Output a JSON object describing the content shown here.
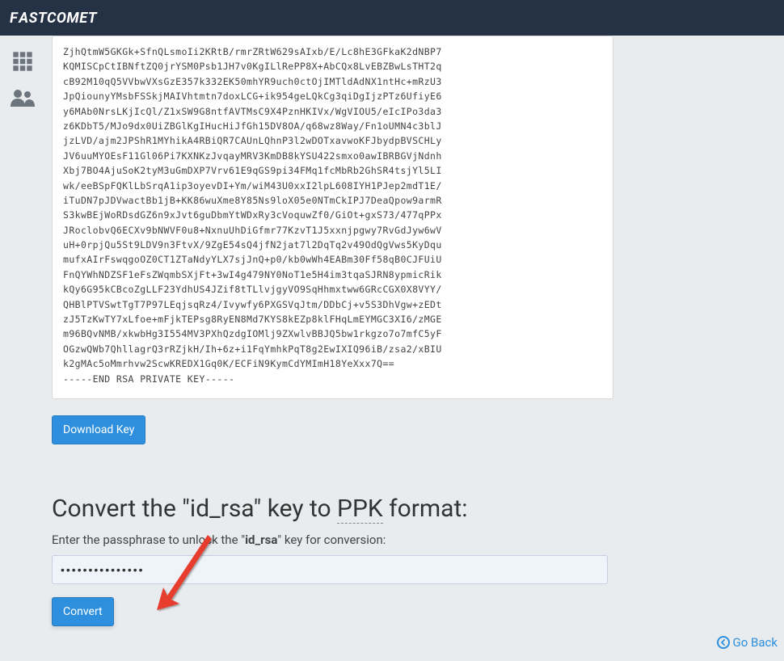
{
  "brand": "FASTCOMET",
  "key_content": "ZjhQtmW5GKGk+SfnQLsmoIi2KRtB/rmrZRtW629sAIxb/E/Lc8hE3GFkaK2dNBP7\nKQMISCpCtIBNftZQ0jrYSM0Psb1JH7v0KgILlRePP8X+AbCQx8LvEBZBwLsTHT2q\ncB92M10qQ5VVbwVXsGzE357k332EK50mhYR9uch0ctOjIMTldAdNX1ntHc+mRzU3\nJpQiounyYMsbFSSkjMAIVhtmtn7doxLCG+ik954geLQkCg3qiDgIjzPTz6UfiyE6\ny6MAb0NrsLKjIcQl/Z1xSW9G8ntfAVTMsC9X4PznHKIVx/WgVIOU5/eIcIPo3da3\nz6KDbT5/MJo9dx0UiZBGlKgIHucHiJfGh15DV8OA/q68wz8Way/Fn1oUMN4c3blJ\njzLVD/ajm2JPShR1MYhikA4RBiQR7CAUnLQhnP3l2wDOTxavwoKFJbydpBVSCHLy\nJV6uuMYOEsF11Gl06Pi7KXNKzJvqayMRV3KmDB8kYSU422smxo0awIBRBGVjNdnh\nXbj7BO4AjuSoK2tyM3uGmDXP7Vrv61E9qGS9pi34FMq1fcMbRb2GhSR4tsjYl5LI\nwk/eeBSpFQKlLbSrqA1ip3oyevDI+Ym/wiM43U0xxI2lpL608IYH1PJep2mdT1E/\niTuDN7pJDVwactBb1jB+KK86wuXme8Y85Ns9loX05e0NTmCkIPJ7DeaQpow9armR\nS3kwBEjWoRDsdGZ6n9xJvt6guDbmYtWDxRy3cVoquwZf0/GiOt+gxS73/477qPPx\nJRoclobvQ6ECXv9bNWVF0u8+NxnuUhDiGfmr77KzvT1J5xxnjpgwy7RvGdJyw6wV\nuH+0rpjQu5St9LDV9n3FtvX/9ZgE54sQ4jfN2jat7l2DqTq2v49OdQgVws5KyDqu\nmufxAIrFswqgoOZ0CT1ZTaNdyYLX7sjJnQ+p0/kb0wWh4EABm30Ff58qB0CJFUiU\nFnQYWhNDZSF1eFsZWqmbSXjFt+3wI4g479NY0NoT1e5H4im3tqaSJRN8ypmicRik\nkQy6G95kCBcoZgLLF23YdhUS4JZif8tTLlvjgyVO9SqHhmxtww6GRcCGX0X8VYY/\nQHBlPTVSwtTgT7P97LEqjsqRz4/Ivywfy6PXGSVqJtm/DDbCj+v5S3DhVgw+zEDt\nzJ5TzKwTY7xLfoe+mFjkTEPsg8RyEN8Md7KYS8kEZp8klFHqLmEYMGC3XI6/zMGE\nm96BQvNMB/xkwbHg3I554MV3PXhQzdgIOMlj9ZXwlvBBJQ5bw1rkgzo7o7mfC5yF\nOGzwQWb7QhllagrQ3rRZjkH/Ih+6z+i1FqYmhkPqT8g2EwIXIQ96iB/zsa2/xBIU\nk2gMAc5oMmrhvw2ScwKREDX1Gq0K/ECFiN9KymCdYMImH18YeXxx7Q==\n-----END RSA PRIVATE KEY-----",
  "buttons": {
    "download": "Download Key",
    "convert": "Convert"
  },
  "heading": {
    "pre": "Convert the \"id_rsa\" key to ",
    "ppk": "PPK",
    "post": " format:"
  },
  "instruction": {
    "pre": "Enter the passphrase to unlock the \"",
    "keyname": "id_rsa",
    "post": "\" key for conversion:"
  },
  "password_value": "•••••••••••••••",
  "goback": "Go Back"
}
